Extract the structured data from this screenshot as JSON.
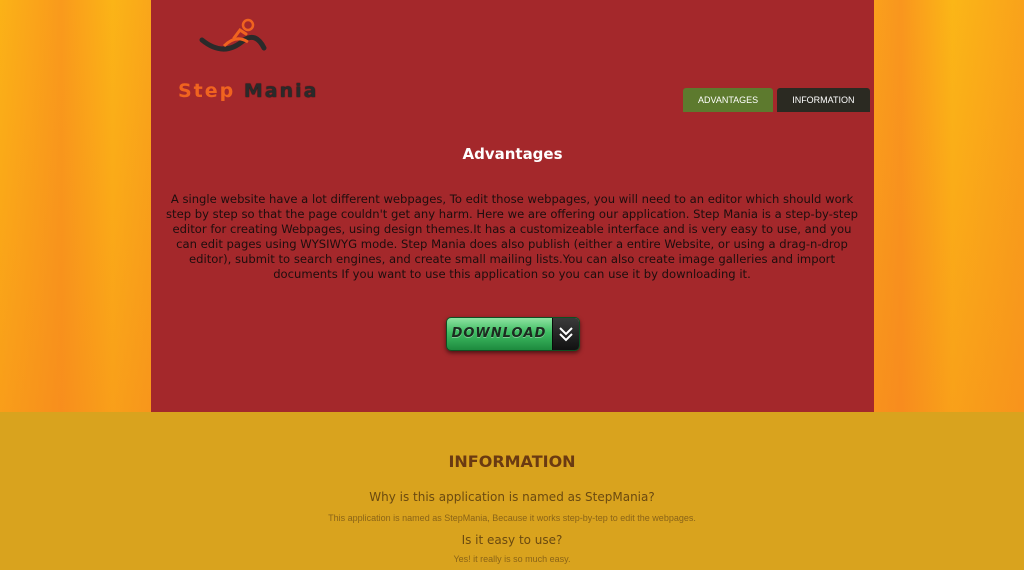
{
  "logo": {
    "word1": "Step",
    "word2": "Mania"
  },
  "nav": {
    "tabs": [
      "ADVANTAGES",
      "INFORMATION"
    ]
  },
  "advantages": {
    "title": "Advantages",
    "text": "A single website have a lot different webpages, To edit those webpages, you will need to an editor which should work step by step so that the page couldn't get any harm. Here we are offering our application. Step Mania is a step-by-step editor for creating Webpages, using design themes.It has a customizeable interface and is very easy to use, and you can edit pages using WYSIWYG mode. Step Mania does also publish (either a entire Website, or using a drag-n-drop editor), submit to search engines, and create small mailing lists.You can also create image galleries and import documents If you want to use this application so you can use it by downloading it.",
    "download_label": "DOWNLOAD"
  },
  "information": {
    "title": "INFORMATION",
    "faq": [
      {
        "question": "Why is this application is named as StepMania?",
        "answer": "This application is named as StepMania, Because it works step-by-tep to edit the webpages."
      },
      {
        "question": "Is it easy to use?",
        "answer": "Yes! it really is so much easy."
      }
    ]
  },
  "colors": {
    "panel": "#a4282b",
    "tab_advantages": "#5d7a2e",
    "tab_information": "#2b2a22",
    "info_bg": "#d9a31e",
    "logo_orange": "#f0631f"
  },
  "icons": [
    "runner-logo-icon",
    "double-chevron-down-icon"
  ]
}
